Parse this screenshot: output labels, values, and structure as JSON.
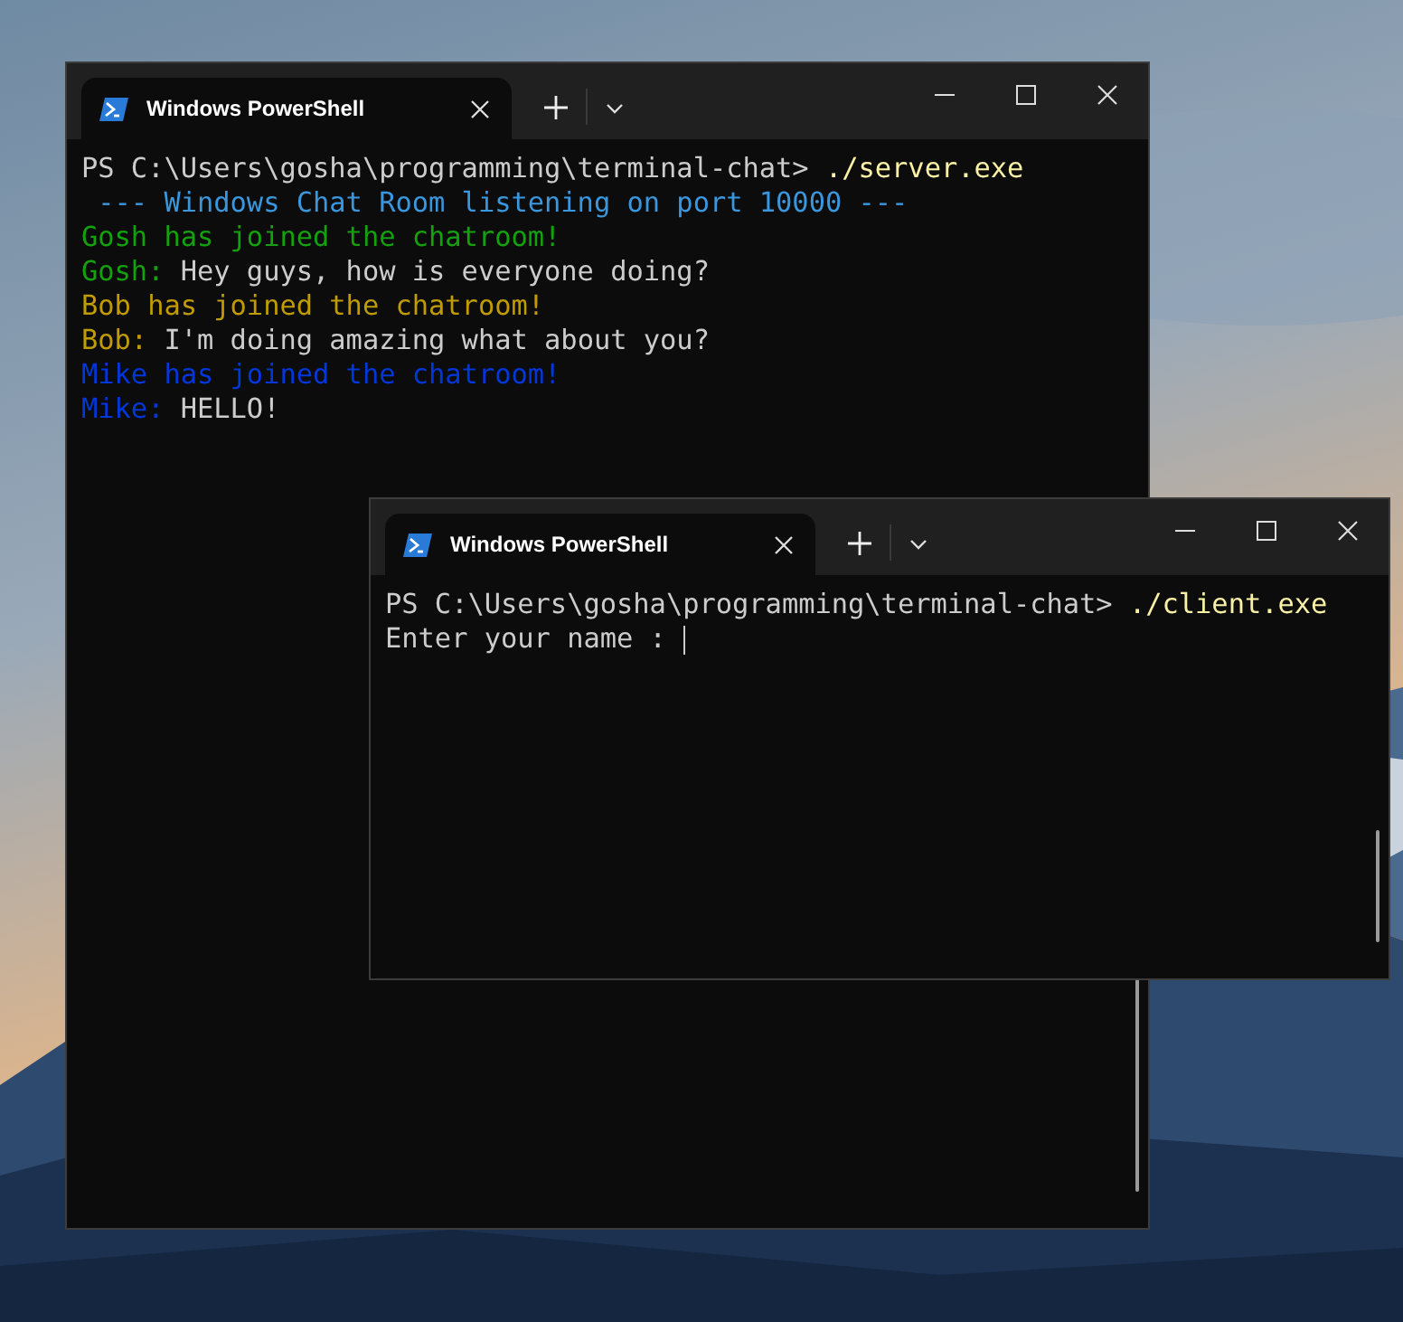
{
  "windows": [
    {
      "tab_title": "Windows PowerShell",
      "lines": [
        [
          {
            "text": "PS C:\\Users\\gosha\\programming\\terminal-chat> ",
            "color": "#cccccc"
          },
          {
            "text": "./server.exe",
            "color": "#f9f1a5"
          }
        ],
        [
          {
            "text": " --- Windows Chat Room listening on port 10000 ---",
            "color": "#3a96dd"
          }
        ],
        [
          {
            "text": "Gosh has joined the chatroom!",
            "color": "#13a10e"
          }
        ],
        [
          {
            "text": "Gosh:",
            "color": "#13a10e"
          },
          {
            "text": " Hey guys, how is everyone doing?",
            "color": "#cccccc"
          }
        ],
        [
          {
            "text": "Bob has joined the chatroom!",
            "color": "#c19c00"
          }
        ],
        [
          {
            "text": "Bob:",
            "color": "#c19c00"
          },
          {
            "text": " I'm doing amazing what about you?",
            "color": "#cccccc"
          }
        ],
        [
          {
            "text": "Mike has joined the chatroom!",
            "color": "#0037da"
          }
        ],
        [
          {
            "text": "Mike:",
            "color": "#0037da"
          },
          {
            "text": " HELLO!",
            "color": "#cccccc"
          }
        ]
      ]
    },
    {
      "tab_title": "Windows PowerShell",
      "lines": [
        [
          {
            "text": "PS C:\\Users\\gosha\\programming\\terminal-chat> ",
            "color": "#cccccc"
          },
          {
            "text": "./client.exe",
            "color": "#f9f1a5"
          }
        ],
        [
          {
            "text": "Enter your name : ",
            "color": "#cccccc"
          }
        ]
      ],
      "cursor": true
    }
  ]
}
